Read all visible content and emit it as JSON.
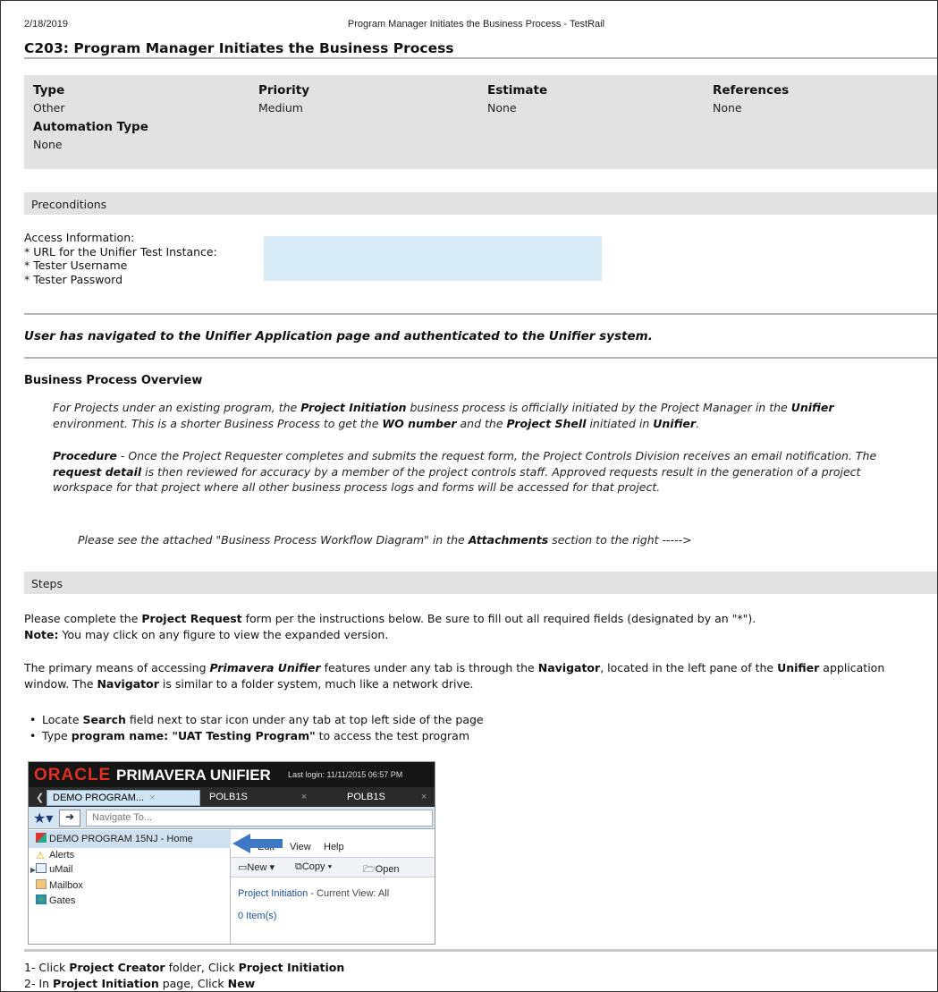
{
  "header": {
    "date": "2/18/2019",
    "doc_title": "Program Manager Initiates the Business Process - TestRail"
  },
  "case_title": "C203: Program Manager Initiates the Business Process",
  "meta": {
    "type_label": "Type",
    "type_value": "Other",
    "priority_label": "Priority",
    "priority_value": "Medium",
    "estimate_label": "Estimate",
    "estimate_value": "None",
    "references_label": "References",
    "references_value": "None",
    "automation_label": "Automation Type",
    "automation_value": "None"
  },
  "preconditions": {
    "heading": "Preconditions",
    "lines": [
      "Access Information:",
      "* URL for the Unifier Test Instance:",
      "* Tester Username",
      "* Tester Password"
    ],
    "statement": "User has navigated to the Unifier Application page and authenticated to the Unifier system.",
    "overview_heading": "Business Process Overview",
    "overview_p1": [
      "For Projects under an existing program, the ",
      "Project Initiation",
      " business process is officially initiated by the Project Manager in the ",
      "Unifier",
      " environment. This is a shorter Business Process to get the ",
      "WO number",
      " and the ",
      "Project Shell",
      " initiated in ",
      "Unifier",
      "."
    ],
    "overview_p2": [
      "Procedure",
      " - Once the Project Requester completes and submits the request form, the Project Controls Division receives an email notification. The ",
      "request detail",
      " is then reviewed for accuracy by a member of the project controls staff. Approved requests result in the generation of a project workspace for that project where all other business process logs and forms will be accessed for that project."
    ],
    "overview_p3": [
      "Please see the attached \"Business Process Workflow Diagram\" in the ",
      "Attachments",
      " section to the right ----->"
    ]
  },
  "steps": {
    "heading": "Steps",
    "p1": [
      "Please complete the ",
      "Project Request",
      " form per the instructions below. Be sure to fill out all required fields (designated by an \"*\")."
    ],
    "p1_note_label": "Note:",
    "p1_note": " You may click on any figure to view the expanded version.",
    "p2": [
      "The primary means of accessing ",
      "Primavera Unifier",
      " features under any tab is through the ",
      "Navigator",
      ", located in the left pane of the ",
      "Unifier",
      " application window. The ",
      "Navigator",
      " is similar to a folder system, much like a network drive."
    ],
    "bullets": [
      [
        "Locate ",
        "Search",
        " field next to star icon under any tab at top left side of the page"
      ],
      [
        "Type ",
        "program name: \"UAT Testing Program\"",
        " to access the test program"
      ]
    ],
    "numbered": [
      [
        "1- Click ",
        "Project Creator",
        " folder, Click ",
        "Project Initiation"
      ],
      [
        "2- In ",
        "Project Initiation",
        " page, Click ",
        "New"
      ]
    ]
  },
  "screenshot": {
    "brand_oracle": "ORACLE",
    "brand_product": "PRIMAVERA UNIFIER",
    "last_login": "Last login: 11/11/2015 06:57 PM",
    "tabs": [
      "DEMO PROGRAM...",
      "POLB1S",
      "POLB1S"
    ],
    "nav_placeholder": "Navigate To...",
    "tree": [
      "DEMO PROGRAM 15NJ - Home",
      "Alerts",
      "uMail",
      "Mailbox",
      "Gates"
    ],
    "menu": [
      "Edit",
      "View",
      "Help"
    ],
    "toolbar": [
      "New",
      "Copy",
      "Open"
    ],
    "view_title": "Project Initiation",
    "view_suffix": " - Current View: All",
    "item_count": "0 Item(s)"
  }
}
